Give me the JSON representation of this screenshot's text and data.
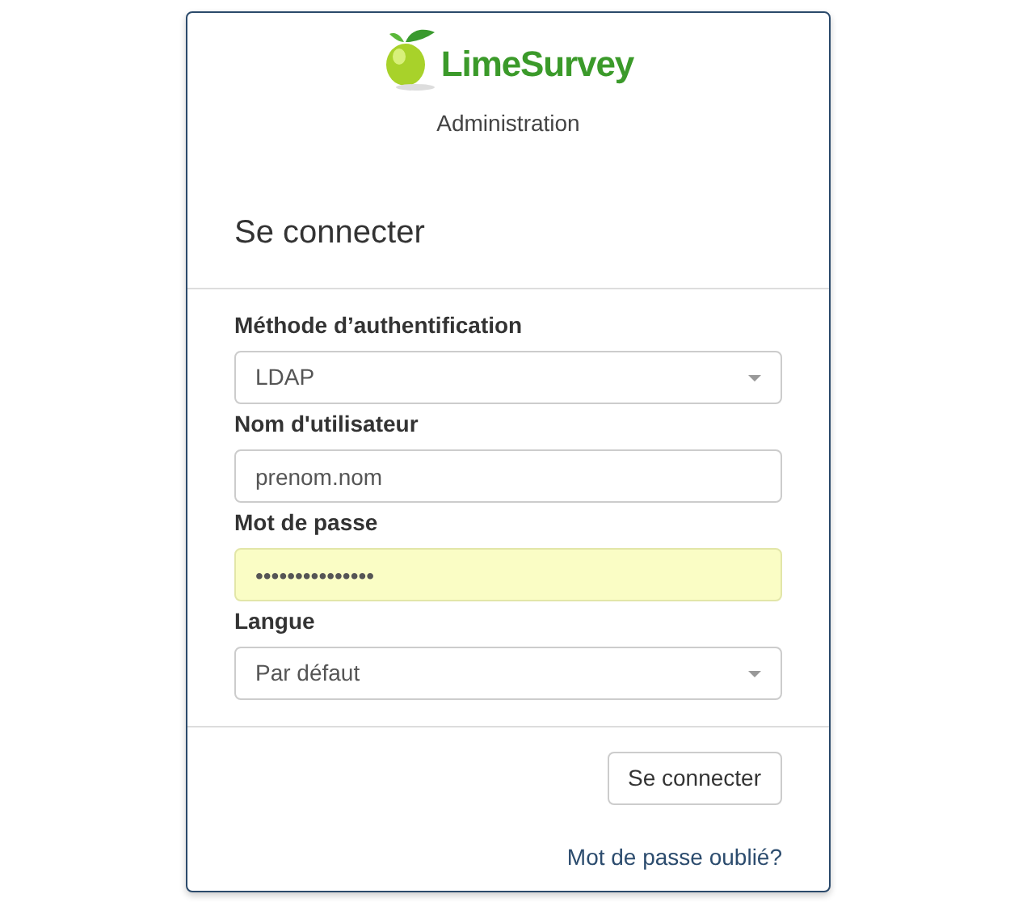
{
  "logo": {
    "text": "LimeSurvey"
  },
  "subtitle": "Administration",
  "heading": "Se connecter",
  "fields": [
    {
      "kind": "select",
      "label": "Méthode d’authentification",
      "value": "LDAP",
      "autofilled": false
    },
    {
      "kind": "text",
      "label": "Nom d'utilisateur",
      "value": "prenom.nom",
      "autofilled": false
    },
    {
      "kind": "password",
      "label": "Mot de passe",
      "value": "•••••••••••••••",
      "autofilled": true
    },
    {
      "kind": "select",
      "label": "Langue",
      "value": "Par défaut",
      "autofilled": false
    }
  ],
  "submit_button": "Se connecter",
  "forgot_link": "Mot de passe oublié?"
}
